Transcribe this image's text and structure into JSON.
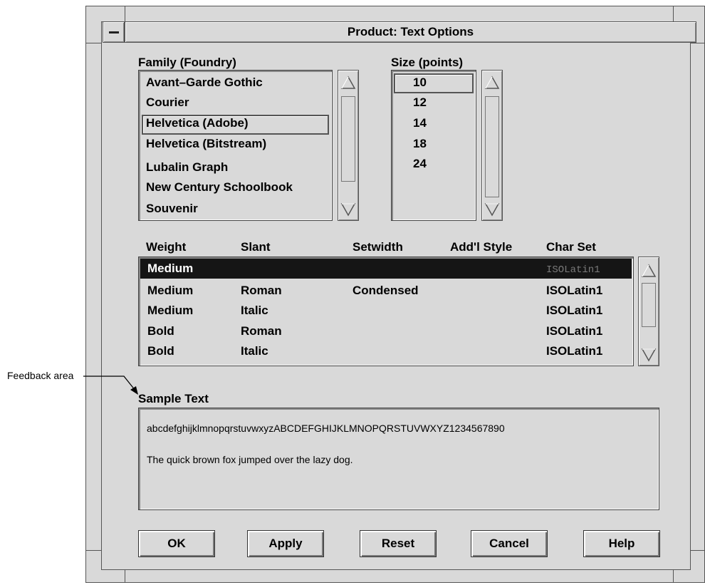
{
  "window": {
    "title": "Product: Text Options"
  },
  "family": {
    "label": "Family (Foundry)",
    "items": [
      "Avant–Garde Gothic",
      "Courier",
      "Helvetica (Adobe)",
      "Helvetica (Bitstream)",
      "Lubalin Graph",
      "New Century Schoolbook",
      "Souvenir"
    ],
    "selected": "Helvetica (Adobe)"
  },
  "size": {
    "label": "Size (points)",
    "items": [
      "10",
      "12",
      "14",
      "18",
      "24"
    ],
    "selected": "10"
  },
  "style_table": {
    "headers": [
      "Weight",
      "Slant",
      "Setwidth",
      "Add'l Style",
      "Char Set"
    ],
    "rows": [
      [
        "Medium",
        "",
        "",
        "",
        "ISOLatin1"
      ],
      [
        "Medium",
        "Roman",
        "Condensed",
        "",
        "ISOLatin1"
      ],
      [
        "Medium",
        "Italic",
        "",
        "",
        "ISOLatin1"
      ],
      [
        "Bold",
        "Roman",
        "",
        "",
        "ISOLatin1"
      ],
      [
        "Bold",
        "Italic",
        "",
        "",
        "ISOLatin1"
      ]
    ],
    "selected_row": 0
  },
  "sample": {
    "label": "Sample Text",
    "line1": "abcdefghijklmnopqrstuvwxyzABCDEFGHIJKLMNOPQRSTUVWXYZ1234567890",
    "line2": "The quick brown fox jumped over the lazy dog."
  },
  "buttons": {
    "ok": "OK",
    "apply": "Apply",
    "reset": "Reset",
    "cancel": "Cancel",
    "help": "Help"
  },
  "callout": {
    "label": "Feedback area"
  },
  "icons": {
    "window_menu": "window-menu-icon",
    "scroll_up": "triangle-up-icon",
    "scroll_down": "triangle-down-icon"
  },
  "colors": {
    "background": "#d9d9d9",
    "selection": "#151515",
    "selection_text": "#ffffff"
  }
}
